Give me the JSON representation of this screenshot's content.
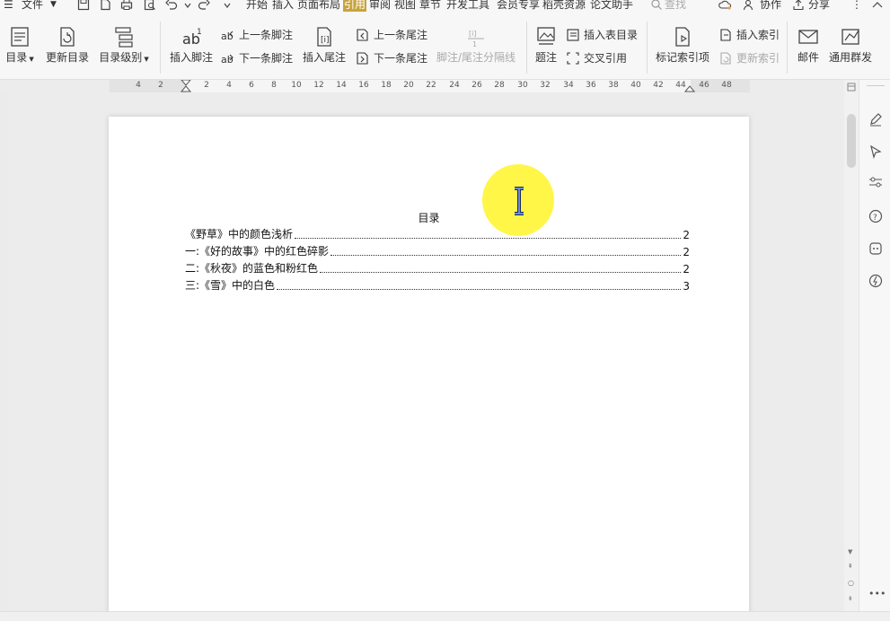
{
  "menubar": {
    "file_label": "文件",
    "tabs": [
      "开始",
      "插入",
      "页面布局",
      "引用",
      "审阅",
      "视图",
      "章节",
      "开发工具",
      "会员专享",
      "稻壳资源",
      "论文助手"
    ],
    "active_tab": "引用",
    "search_placeholder": "查找",
    "collab_label": "协作",
    "share_label": "分享"
  },
  "ribbon": {
    "toc_label": "目录",
    "update_toc_label": "更新目录",
    "toc_level_label": "目录级别",
    "insert_footnote_label": "插入脚注",
    "prev_footnote_label": "上一条脚注",
    "next_footnote_label": "下一条脚注",
    "insert_endnote_label": "插入尾注",
    "prev_endnote_label": "上一条尾注",
    "next_endnote_label": "下一条尾注",
    "separator_label": "脚注/尾注分隔线",
    "caption_label": "题注",
    "insert_table_toc_label": "插入表目录",
    "cross_ref_label": "交叉引用",
    "mark_index_label": "标记索引项",
    "insert_index_label": "插入索引",
    "update_index_label": "更新索引",
    "mail_label": "邮件",
    "mass_mail_label": "通用群发"
  },
  "ruler": {
    "ticks": [
      "4",
      "2",
      "2",
      "4",
      "6",
      "8",
      "10",
      "12",
      "14",
      "16",
      "18",
      "20",
      "22",
      "24",
      "26",
      "28",
      "30",
      "32",
      "34",
      "36",
      "38",
      "40",
      "42",
      "44",
      "46",
      "48"
    ]
  },
  "document": {
    "toc_title": "目录",
    "toc_entries": [
      {
        "text": "《野草》中的颜色浅析",
        "page": "2"
      },
      {
        "text": "一:《好的故事》中的红色碎影",
        "page": "2"
      },
      {
        "text": "二:《秋夜》的蓝色和粉红色",
        "page": "2"
      },
      {
        "text": "三:《雪》中的白色",
        "page": "3"
      }
    ]
  },
  "colors": {
    "active_tab_bg": "#c9a43c",
    "cursor_highlight": "#fff528",
    "ibeam": "#3c5aa8"
  }
}
